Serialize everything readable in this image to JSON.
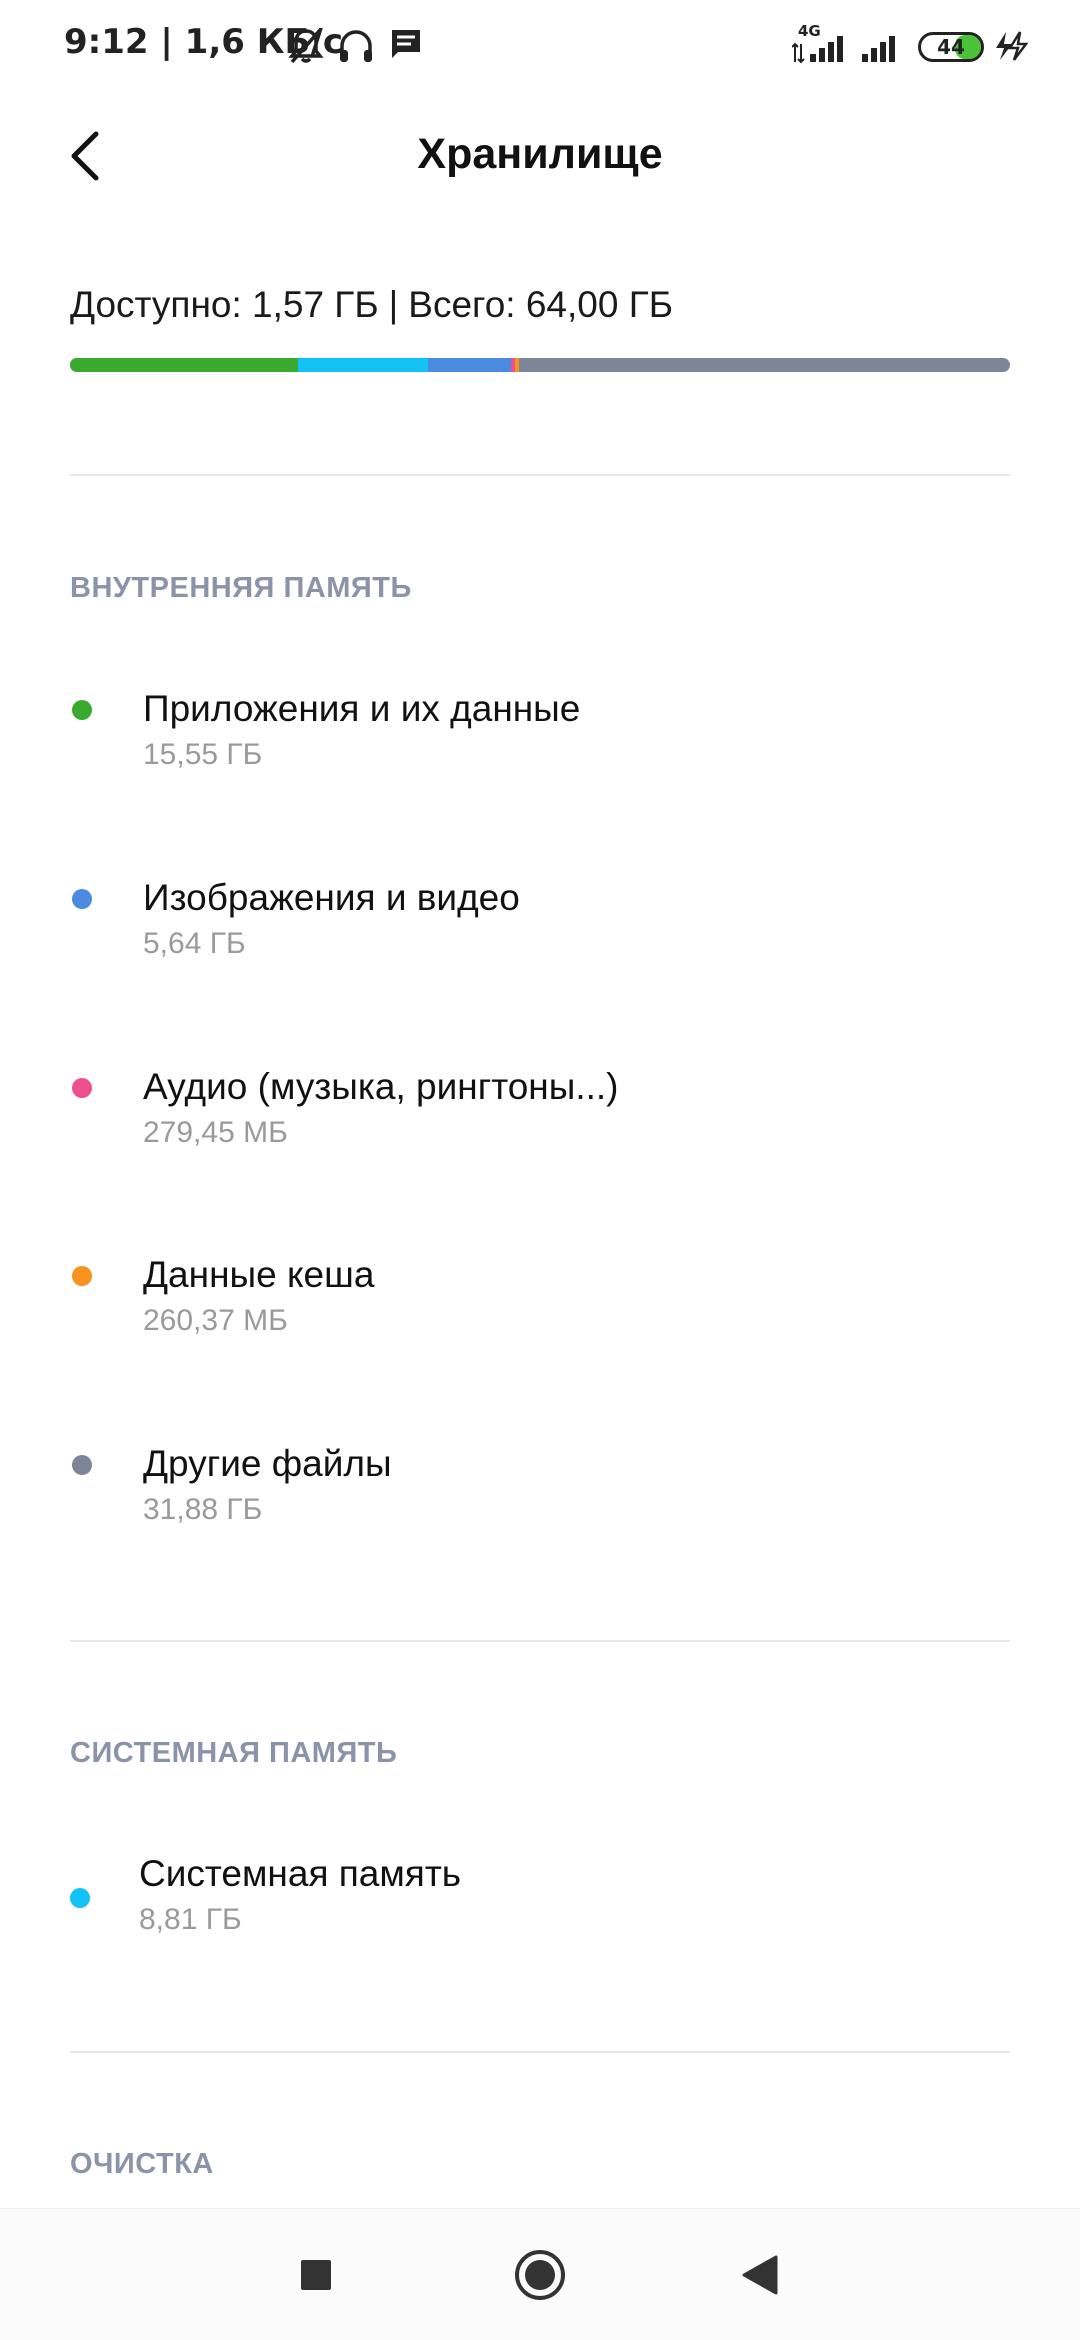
{
  "status_bar": {
    "time_speed": "9:12 | 1,6 КБ/с",
    "network_type": "4G",
    "battery_level": "44",
    "battery_fraction": 0.44,
    "icons": [
      "bell-off-icon",
      "headphones-icon",
      "message-icon",
      "signal-icon",
      "signal-icon",
      "battery-icon",
      "charging-icon"
    ]
  },
  "header": {
    "title": "Хранилище"
  },
  "summary": {
    "available": "Доступно: 1,57 ГБ",
    "separator": "|",
    "total": "Всего: 64,00 ГБ",
    "segments": [
      {
        "name": "apps",
        "gb": 15.55,
        "color": "#3aaa2e"
      },
      {
        "name": "system",
        "gb": 8.81,
        "color": "#12c2f4"
      },
      {
        "name": "images",
        "gb": 5.64,
        "color": "#4a8ae0"
      },
      {
        "name": "audio",
        "gb": 0.27945,
        "color": "#ee4f8f"
      },
      {
        "name": "cache",
        "gb": 0.26037,
        "color": "#f7931e"
      },
      {
        "name": "other",
        "gb": 31.88,
        "color": "#7c8698"
      }
    ],
    "total_gb": 64.0
  },
  "internal": {
    "header": "ВНУТРЕННЯЯ ПАМЯТЬ",
    "items": [
      {
        "label": "Приложения и их данные",
        "size": "15,55 ГБ",
        "color": "#3aaa2e"
      },
      {
        "label": "Изображения и видео",
        "size": "5,64 ГБ",
        "color": "#4a8ae0"
      },
      {
        "label": "Аудио (музыка, рингтоны...)",
        "size": "279,45 МБ",
        "color": "#ee4f8f"
      },
      {
        "label": "Данные кеша",
        "size": "260,37 МБ",
        "color": "#f7931e"
      },
      {
        "label": "Другие файлы",
        "size": "31,88 ГБ",
        "color": "#7c8698"
      }
    ]
  },
  "system": {
    "header": "СИСТЕМНАЯ ПАМЯТЬ",
    "items": [
      {
        "label": "Системная память",
        "size": "8,81 ГБ",
        "color": "#12c2f4"
      }
    ]
  },
  "cleanup": {
    "header": "ОЧИСТКА"
  },
  "nav": {
    "buttons": [
      "recents-button",
      "home-button",
      "back-button"
    ]
  }
}
